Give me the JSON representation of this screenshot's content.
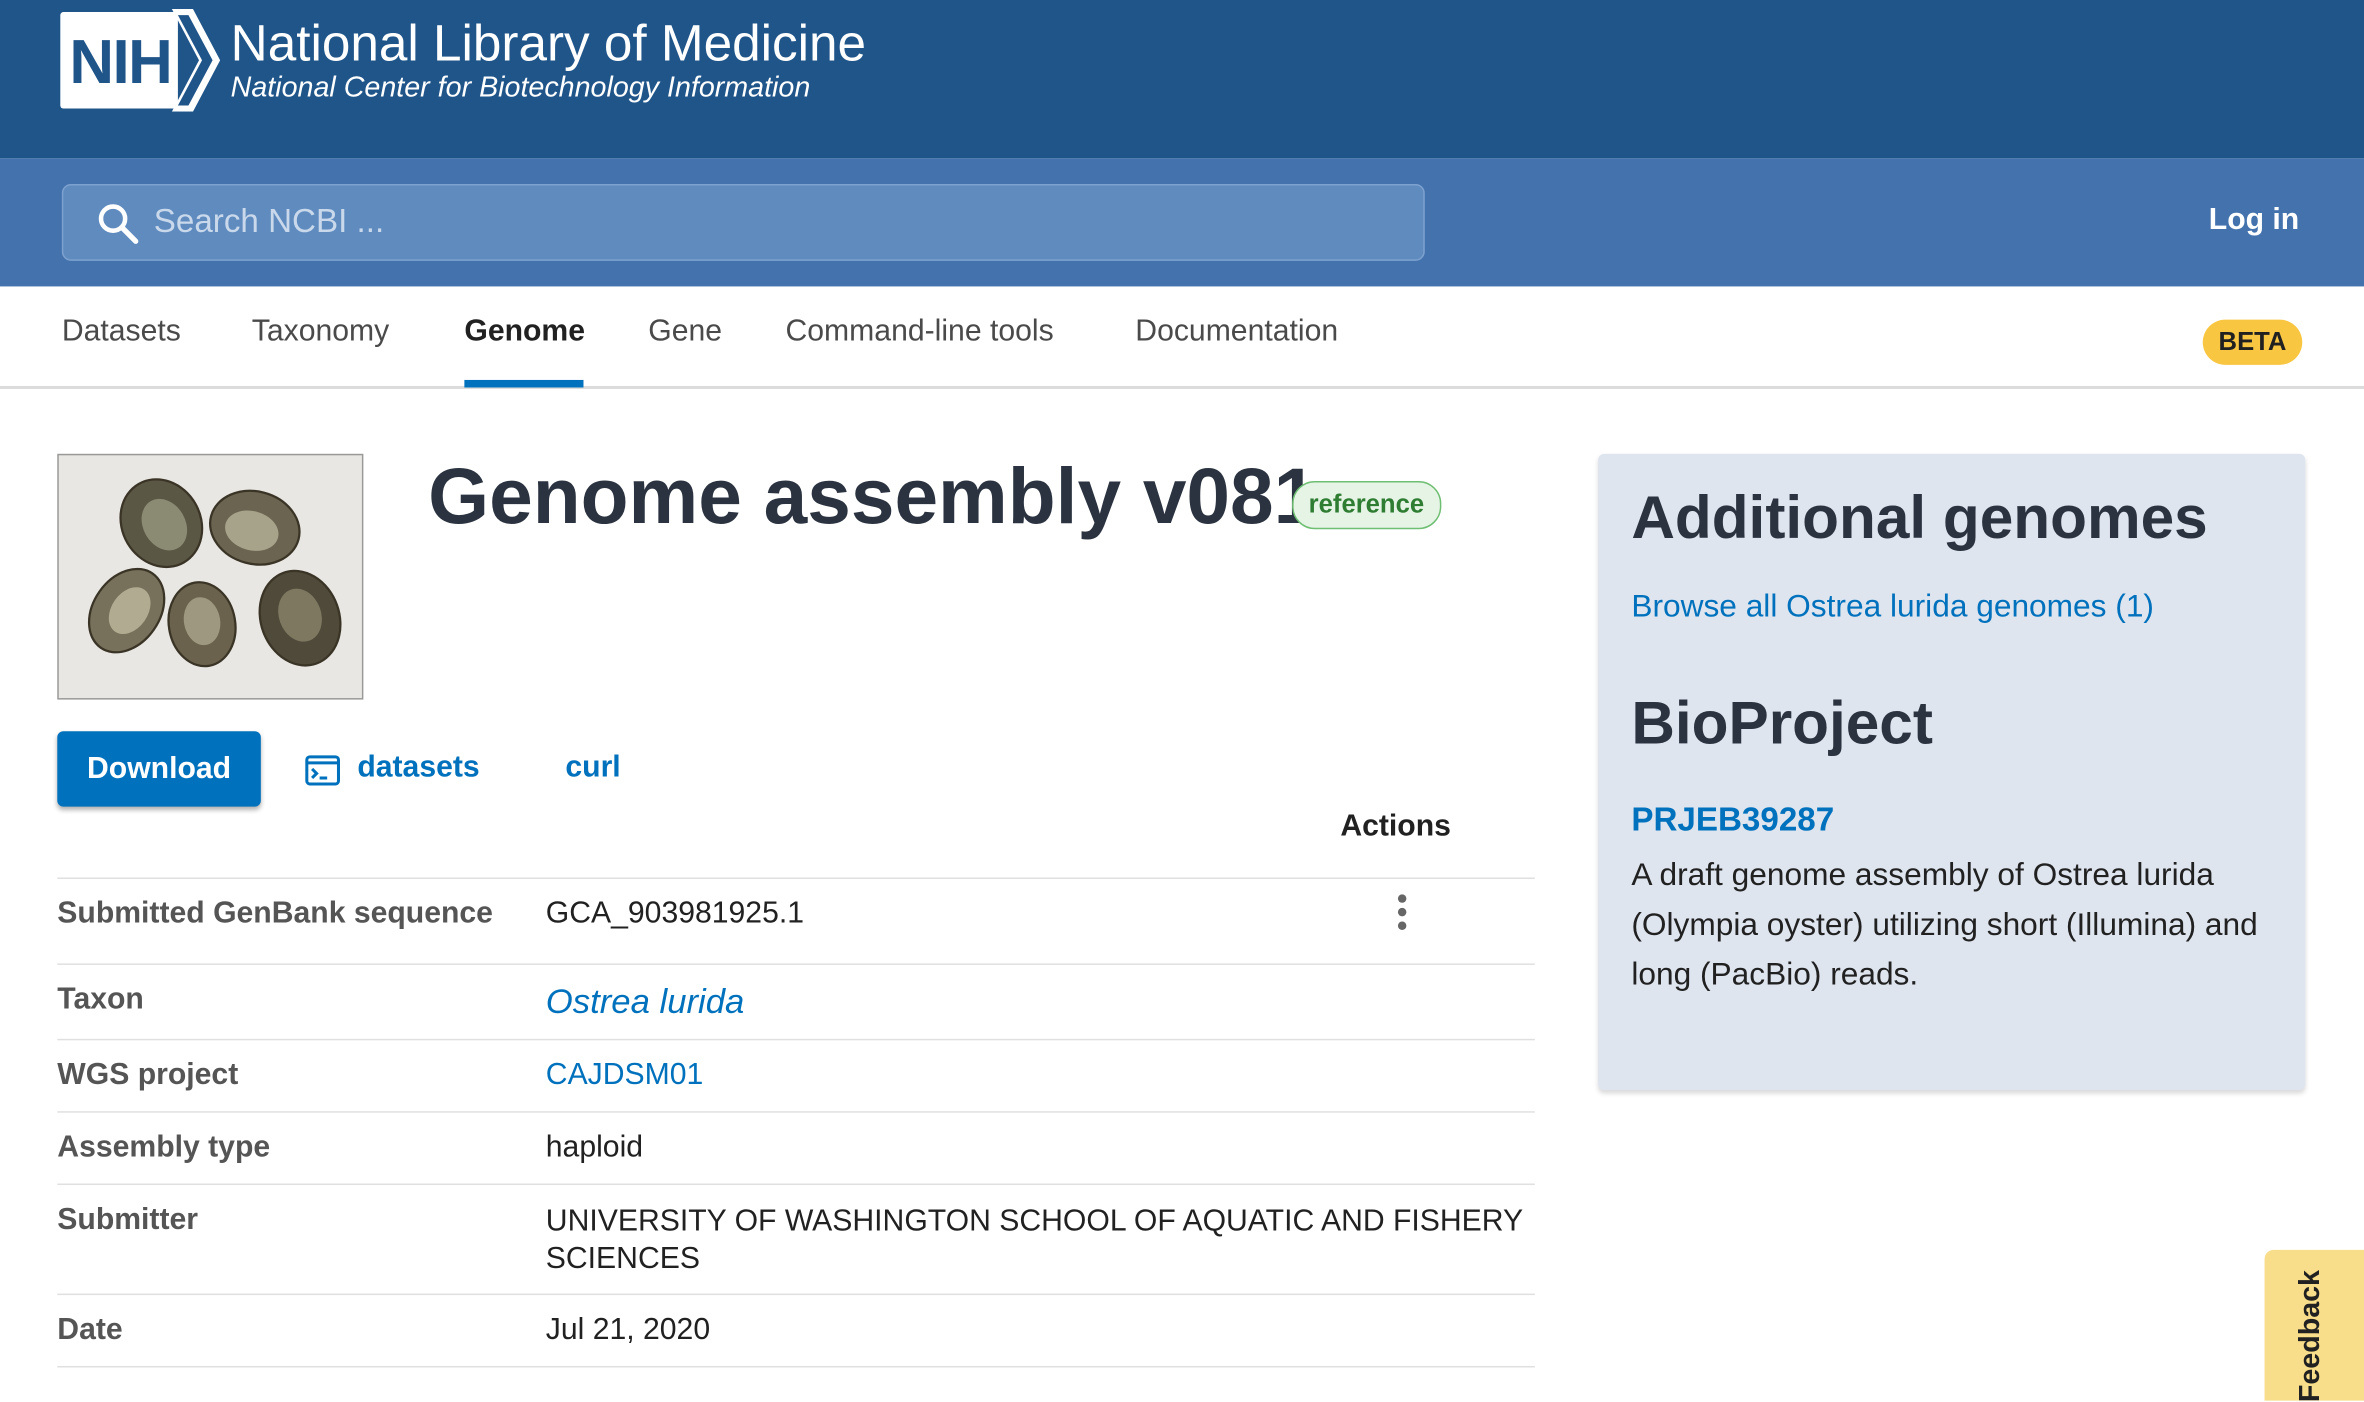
{
  "header": {
    "logo_text": "NIH",
    "title": "National Library of Medicine",
    "subtitle": "National Center for Biotechnology Information"
  },
  "search": {
    "placeholder": "Search NCBI ...",
    "value": ""
  },
  "auth": {
    "login_label": "Log in"
  },
  "nav": {
    "tabs": [
      {
        "label": "Datasets"
      },
      {
        "label": "Taxonomy"
      },
      {
        "label": "Genome",
        "active": true
      },
      {
        "label": "Gene"
      },
      {
        "label": "Command-line tools"
      },
      {
        "label": "Documentation"
      }
    ],
    "badge": "BETA"
  },
  "assembly": {
    "title": "Genome assembly v081",
    "badge": "reference",
    "download_label": "Download",
    "datasets_label": "datasets",
    "curl_label": "curl",
    "actions_header": "Actions",
    "rows": [
      {
        "label": "Submitted GenBank sequence",
        "value": "GCA_903981925.1"
      },
      {
        "label": "Taxon",
        "value": "Ostrea lurida"
      },
      {
        "label": "WGS project",
        "value": "CAJDSM01"
      },
      {
        "label": "Assembly type",
        "value": "haploid"
      },
      {
        "label": "Submitter",
        "value": "UNIVERSITY OF WASHINGTON SCHOOL OF AQUATIC AND FISHERY SCIENCES"
      },
      {
        "label": "Date",
        "value": "Jul 21, 2020"
      }
    ]
  },
  "sidebar": {
    "additional_title": "Additional genomes",
    "browse_link": "Browse all Ostrea lurida genomes (1)",
    "bioproject_title": "BioProject",
    "accession": "PRJEB39287",
    "description": "A draft genome assembly of Ostrea lurida (Olympia oyster) utilizing short (Illumina) and long (PacBio) reads."
  },
  "feedback_label": "Feedback",
  "colors": {
    "header_bg": "#20558a",
    "search_band": "#4472ad",
    "link_blue": "#0071bc",
    "beta_yellow": "#f9c642",
    "panel_bg": "#dfe5ef"
  }
}
